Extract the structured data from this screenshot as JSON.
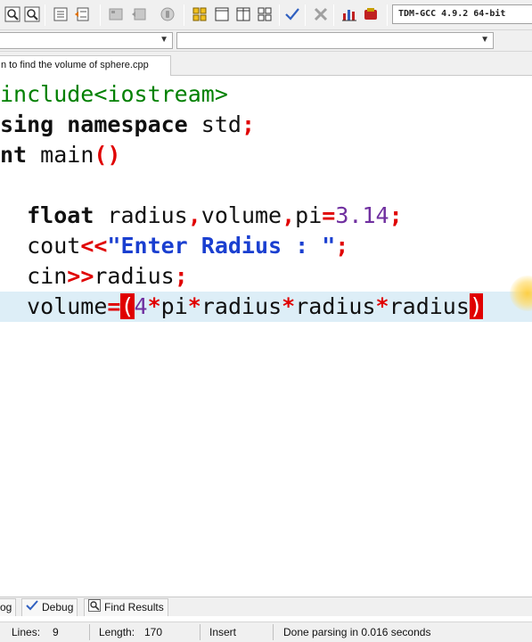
{
  "toolbar": {
    "compiler_select": "TDM-GCC 4.9.2 64-bit",
    "icons": [
      "find-icon",
      "find-in-files-icon",
      "indent-icon",
      "unindent-icon",
      "bookmark-icon",
      "bookmark-next-icon",
      "compile-icon",
      "grid-layout-icon",
      "window-icon",
      "split-icon",
      "options-icon",
      "check-icon",
      "close-icon",
      "chart-icon",
      "debug-icon"
    ]
  },
  "tab": {
    "label": "n to find the volume of sphere.cpp"
  },
  "code_lines": [
    {
      "segments": [
        {
          "cls": "pp",
          "text": "include<iostream>"
        }
      ]
    },
    {
      "segments": [
        {
          "cls": "kw",
          "text": "sing namespace"
        },
        {
          "cls": "",
          "text": " std"
        },
        {
          "cls": "op",
          "text": ";"
        }
      ]
    },
    {
      "segments": [
        {
          "cls": "kw",
          "text": "nt"
        },
        {
          "cls": "",
          "text": " main"
        },
        {
          "cls": "op",
          "text": "()"
        }
      ]
    },
    {
      "segments": []
    },
    {
      "segments": [
        {
          "cls": "",
          "text": "  "
        },
        {
          "cls": "kw",
          "text": "float"
        },
        {
          "cls": "",
          "text": " radius"
        },
        {
          "cls": "op",
          "text": ","
        },
        {
          "cls": "",
          "text": "volume"
        },
        {
          "cls": "op",
          "text": ","
        },
        {
          "cls": "",
          "text": "pi"
        },
        {
          "cls": "op",
          "text": "="
        },
        {
          "cls": "num",
          "text": "3.14"
        },
        {
          "cls": "op",
          "text": ";"
        }
      ]
    },
    {
      "segments": [
        {
          "cls": "",
          "text": "  cout"
        },
        {
          "cls": "op",
          "text": "<<"
        },
        {
          "cls": "str",
          "text": "\"Enter Radius : \""
        },
        {
          "cls": "op",
          "text": ";"
        }
      ]
    },
    {
      "segments": [
        {
          "cls": "",
          "text": "  cin"
        },
        {
          "cls": "op",
          "text": ">>"
        },
        {
          "cls": "",
          "text": "radius"
        },
        {
          "cls": "op",
          "text": ";"
        }
      ]
    },
    {
      "segments": [
        {
          "cls": "",
          "text": "  volume"
        },
        {
          "cls": "op",
          "text": "="
        },
        {
          "cls": "brace",
          "text": "("
        },
        {
          "cls": "num",
          "text": "4"
        },
        {
          "cls": "op",
          "text": "*"
        },
        {
          "cls": "",
          "text": "pi"
        },
        {
          "cls": "op",
          "text": "*"
        },
        {
          "cls": "",
          "text": "radius"
        },
        {
          "cls": "op",
          "text": "*"
        },
        {
          "cls": "",
          "text": "radius"
        },
        {
          "cls": "op",
          "text": "*"
        },
        {
          "cls": "",
          "text": "radius"
        },
        {
          "cls": "brace",
          "text": ")"
        }
      ],
      "current": true
    }
  ],
  "bottom_tabs": {
    "log": "og",
    "debug": "Debug",
    "find_results": "Find Results"
  },
  "status": {
    "lines_label": "Lines:",
    "lines_value": "9",
    "length_label": "Length:",
    "length_value": "170",
    "mode": "Insert",
    "message": "Done parsing in 0.016 seconds"
  }
}
